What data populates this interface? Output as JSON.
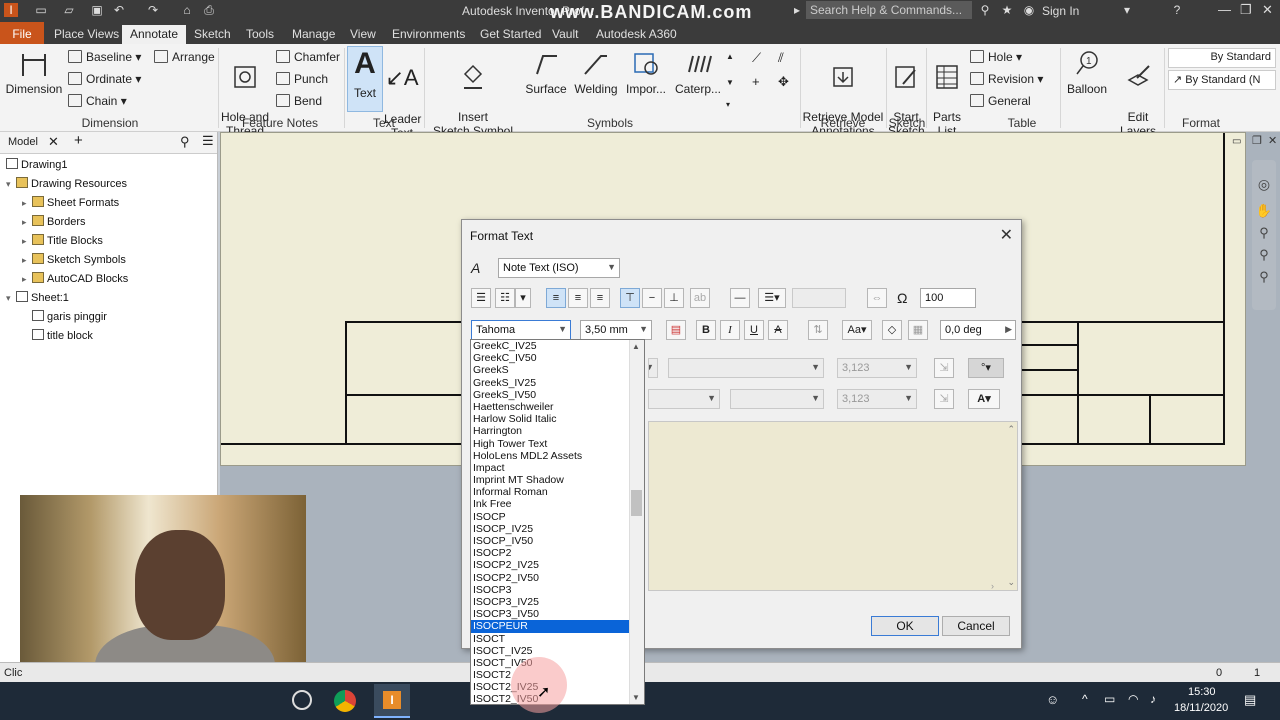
{
  "title_bar": {
    "app_title": "Autodesk Inventor Prof...",
    "watermark": "www.BANDICAM.com",
    "search_placeholder": "Search Help & Commands...",
    "sign_in": "Sign In"
  },
  "menu_tabs": [
    "File",
    "Place Views",
    "Annotate",
    "Sketch",
    "Tools",
    "Manage",
    "View",
    "Environments",
    "Get Started",
    "Vault",
    "Autodesk A360"
  ],
  "active_tab": "Annotate",
  "ribbon": {
    "dimension": {
      "button": "Dimension",
      "baseline": "Baseline",
      "ordinate": "Ordinate",
      "chain": "Chain",
      "arrange": "Arrange",
      "panel": "Dimension"
    },
    "feature_notes": {
      "hole_thread": "Hole and\nThread",
      "chamfer": "Chamfer",
      "punch": "Punch",
      "bend": "Bend",
      "panel": "Feature Notes"
    },
    "text": {
      "text": "Text",
      "leader_text": "Leader\nText",
      "panel": "Text"
    },
    "symbols": {
      "insert_sketch_symbol": "Insert\nSketch Symbol",
      "surface": "Surface",
      "welding": "Welding",
      "import": "Impor...",
      "caterpillar": "Caterp...",
      "panel": "Symbols"
    },
    "retrieve": {
      "retrieve_model_annotations": "Retrieve Model\nAnnotations",
      "panel": "Retrieve"
    },
    "sketch": {
      "start_sketch": "Start\nSketch",
      "panel": "Sketch"
    },
    "table": {
      "parts_list": "Parts\nList",
      "hole": "Hole",
      "revision": "Revision",
      "general": "General",
      "panel": "Table"
    },
    "balloon": "Balloon",
    "edit_layers": "Edit\nLayers",
    "format": {
      "style1": "By Standard",
      "style2": "By Standard (N",
      "panel": "Format"
    }
  },
  "browser": {
    "header": "Model",
    "tree": [
      {
        "label": "Drawing1",
        "level": 0
      },
      {
        "label": "Drawing Resources",
        "level": 1
      },
      {
        "label": "Sheet Formats",
        "level": 2
      },
      {
        "label": "Borders",
        "level": 2
      },
      {
        "label": "Title Blocks",
        "level": 2
      },
      {
        "label": "Sketch Symbols",
        "level": 2
      },
      {
        "label": "AutoCAD Blocks",
        "level": 2
      },
      {
        "label": "Sheet:1",
        "level": 1
      },
      {
        "label": "garis pinggir",
        "level": 2
      },
      {
        "label": "title block",
        "level": 2
      }
    ]
  },
  "dialog": {
    "title": "Format Text",
    "style": "Note Text (ISO)",
    "stretch_percent": "100",
    "font": "Tahoma",
    "size": "3,50 mm",
    "rotation": "0,0 deg",
    "param_value1": "3,123",
    "param_value2": "3,123",
    "ok": "OK",
    "cancel": "Cancel"
  },
  "font_list": {
    "selected": "ISOCPEUR",
    "items": [
      "GreekC_IV25",
      "GreekC_IV50",
      "GreekS",
      "GreekS_IV25",
      "GreekS_IV50",
      "Haettenschweiler",
      "Harlow Solid Italic",
      "Harrington",
      "High Tower Text",
      "HoloLens MDL2 Assets",
      "Impact",
      "Imprint MT Shadow",
      "Informal Roman",
      "Ink Free",
      "ISOCP",
      "ISOCP_IV25",
      "ISOCP_IV50",
      "ISOCP2",
      "ISOCP2_IV25",
      "ISOCP2_IV50",
      "ISOCP3",
      "ISOCP3_IV25",
      "ISOCP3_IV50",
      "ISOCPEUR",
      "ISOCT",
      "ISOCT_IV25",
      "ISOCT_IV50",
      "ISOCT2",
      "ISOCT2_IV25",
      "ISOCT2_IV50"
    ]
  },
  "status": {
    "left": "Clic",
    "val1": "0",
    "val2": "1"
  },
  "taskbar": {
    "time": "15:30",
    "date": "18/11/2020"
  }
}
